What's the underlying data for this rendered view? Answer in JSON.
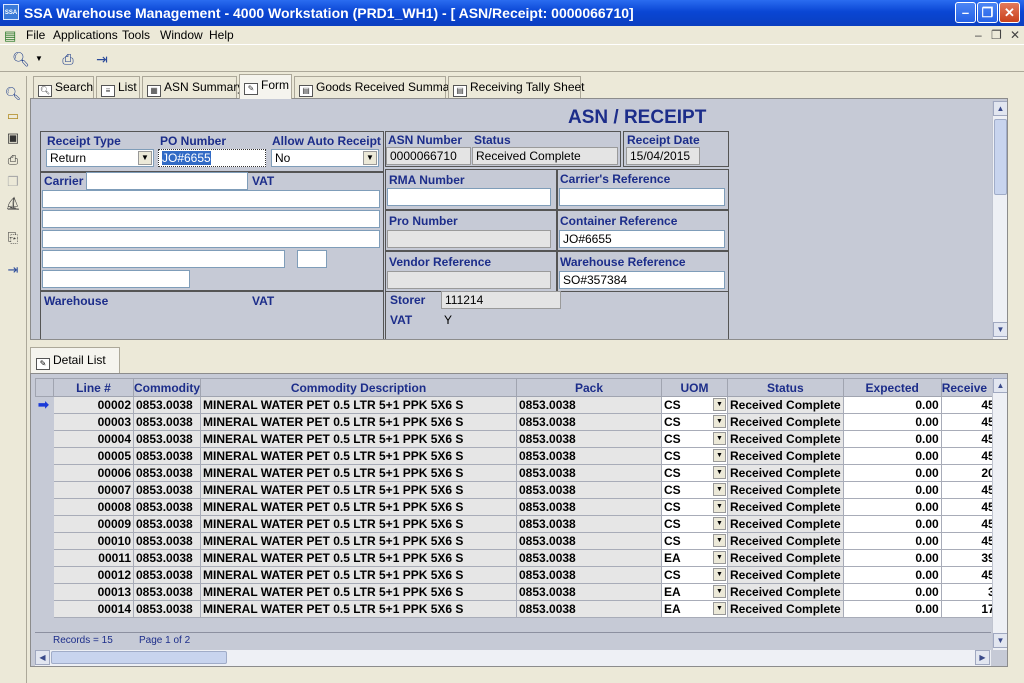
{
  "window": {
    "title": "SSA Warehouse Management - 4000 Workstation (PRD1_WH1) - [ ASN/Receipt: 0000066710]",
    "icon_text": "SSA"
  },
  "menu": [
    "File",
    "Applications",
    "Tools",
    "Window",
    "Help"
  ],
  "tabs": [
    {
      "label": "Search",
      "icon": "search-icon"
    },
    {
      "label": "List",
      "icon": "list-icon"
    },
    {
      "label": "ASN Summary",
      "icon": "summary-icon"
    },
    {
      "label": "Form",
      "icon": "form-icon",
      "active": true
    },
    {
      "label": "Goods Received Summary",
      "icon": "report-icon"
    },
    {
      "label": "Receiving Tally Sheet",
      "icon": "report-icon"
    }
  ],
  "form": {
    "heading": "ASN / RECEIPT",
    "receipt_type_label": "Receipt Type",
    "receipt_type": "Return",
    "po_number_label": "PO Number",
    "po_number": "JO#6655",
    "allow_auto_receipt_label": "Allow Auto Receipt",
    "allow_auto_receipt": "No",
    "asn_number_label": "ASN Number",
    "asn_number": "0000066710",
    "status_label": "Status",
    "status": "Received Complete",
    "receipt_date_label": "Receipt Date",
    "receipt_date": "15/04/2015",
    "carrier_label": "Carrier",
    "carrier_vat_label": "VAT",
    "rma_number_label": "RMA Number",
    "rma_number": "",
    "carriers_reference_label": "Carrier's Reference",
    "carriers_reference": "",
    "pro_number_label": "Pro Number",
    "pro_number": "",
    "container_reference_label": "Container Reference",
    "container_reference": "JO#6655",
    "vendor_reference_label": "Vendor Reference",
    "vendor_reference": "",
    "warehouse_reference_label": "Warehouse Reference",
    "warehouse_reference": "SO#357384",
    "warehouse_label": "Warehouse",
    "warehouse_vat_label": "VAT",
    "storer_label": "Storer",
    "storer": "111214",
    "storer_vat_label": "VAT",
    "storer_vat": "Y"
  },
  "detail": {
    "tab_label": "Detail List",
    "columns": [
      "Line #",
      "Commodity",
      "Commodity Description",
      "Pack",
      "UOM",
      "Status",
      "Expected",
      "Receive"
    ],
    "rows": [
      [
        "00002",
        "0853.0038",
        "MINERAL WATER PET  0.5 LTR 5+1 PPK   5X6 S",
        "0853.0038",
        "CS",
        "Received Complete",
        "0.00",
        "45"
      ],
      [
        "00003",
        "0853.0038",
        "MINERAL WATER PET  0.5 LTR 5+1 PPK   5X6 S",
        "0853.0038",
        "CS",
        "Received Complete",
        "0.00",
        "45"
      ],
      [
        "00004",
        "0853.0038",
        "MINERAL WATER PET  0.5 LTR 5+1 PPK   5X6 S",
        "0853.0038",
        "CS",
        "Received Complete",
        "0.00",
        "45"
      ],
      [
        "00005",
        "0853.0038",
        "MINERAL WATER PET  0.5 LTR 5+1 PPK   5X6 S",
        "0853.0038",
        "CS",
        "Received Complete",
        "0.00",
        "45"
      ],
      [
        "00006",
        "0853.0038",
        "MINERAL WATER PET  0.5 LTR 5+1 PPK   5X6 S",
        "0853.0038",
        "CS",
        "Received Complete",
        "0.00",
        "20"
      ],
      [
        "00007",
        "0853.0038",
        "MINERAL WATER PET  0.5 LTR 5+1 PPK   5X6 S",
        "0853.0038",
        "CS",
        "Received Complete",
        "0.00",
        "45"
      ],
      [
        "00008",
        "0853.0038",
        "MINERAL WATER PET  0.5 LTR 5+1 PPK   5X6 S",
        "0853.0038",
        "CS",
        "Received Complete",
        "0.00",
        "45"
      ],
      [
        "00009",
        "0853.0038",
        "MINERAL WATER PET  0.5 LTR 5+1 PPK   5X6 S",
        "0853.0038",
        "CS",
        "Received Complete",
        "0.00",
        "45"
      ],
      [
        "00010",
        "0853.0038",
        "MINERAL WATER PET  0.5 LTR 5+1 PPK   5X6 S",
        "0853.0038",
        "CS",
        "Received Complete",
        "0.00",
        "45"
      ],
      [
        "00011",
        "0853.0038",
        "MINERAL WATER PET  0.5 LTR 5+1 PPK   5X6 S",
        "0853.0038",
        "EA",
        "Received Complete",
        "0.00",
        "39"
      ],
      [
        "00012",
        "0853.0038",
        "MINERAL WATER PET  0.5 LTR 5+1 PPK   5X6 S",
        "0853.0038",
        "CS",
        "Received Complete",
        "0.00",
        "45"
      ],
      [
        "00013",
        "0853.0038",
        "MINERAL WATER PET  0.5 LTR 5+1 PPK   5X6 S",
        "0853.0038",
        "EA",
        "Received Complete",
        "0.00",
        "3"
      ],
      [
        "00014",
        "0853.0038",
        "MINERAL WATER PET  0.5 LTR 5+1 PPK   5X6 S",
        "0853.0038",
        "EA",
        "Received Complete",
        "0.00",
        "17"
      ]
    ],
    "records_text": "Records = 15",
    "page_text": "Page 1 of 2"
  },
  "colors": {
    "title_bar": "#0a46d4",
    "label_blue": "#1c2d8a",
    "panel": "#c6cad6"
  }
}
